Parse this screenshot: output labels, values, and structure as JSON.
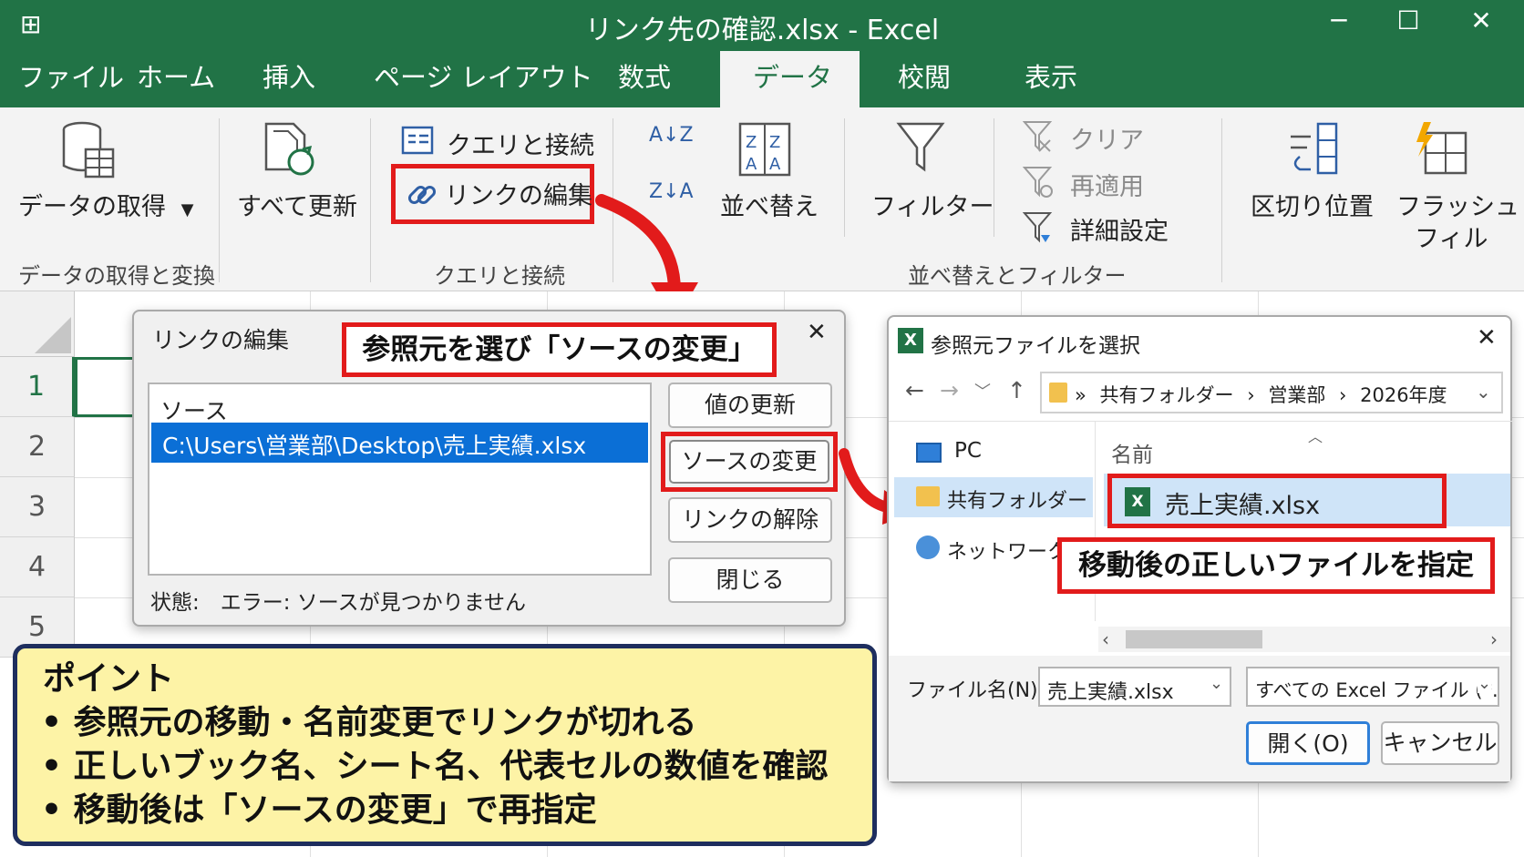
{
  "window": {
    "title": "リンク先の確認.xlsx - Excel",
    "controls": {
      "minimize": "─",
      "maximize": "☐",
      "close": "✕"
    }
  },
  "tabs": [
    "ファイル",
    "ホーム",
    "挿入",
    "ページ レイアウト",
    "数式",
    "データ",
    "校閲",
    "表示"
  ],
  "active_tab": "データ",
  "ribbon": {
    "get_data": "データの取得",
    "refresh_all": "すべて更新",
    "queries": "クエリと接続",
    "edit_links": "リンクの編集",
    "sort": "並べ替え",
    "sort_az": "A↓Z",
    "sort_za": "Z↓A",
    "filter": "フィルター",
    "clear": "クリア",
    "reapply": "再適用",
    "advanced": "詳細設定",
    "text_to_columns": "区切り位置",
    "flash_fill_1": "フラッシュ",
    "flash_fill_2": "フィル",
    "groups": {
      "get_transform": "データの取得と変換",
      "queries": "クエリと接続",
      "sort_filter": "並べ替えとフィルター"
    }
  },
  "rows": [
    "1",
    "2",
    "3",
    "4",
    "5"
  ],
  "edit_links_dialog": {
    "title": "リンクの編集",
    "close": "✕",
    "column_header": "ソース",
    "selected_source": "C:\\Users\\営業部\\Desktop\\売上実績.xlsx",
    "buttons": {
      "update": "値の更新",
      "change_source": "ソースの変更",
      "break": "リンクの解除",
      "close": "閉じる"
    },
    "status": "状態:　エラー: ソースが見つかりません"
  },
  "callout_select": "参照元を選び「ソースの変更」",
  "file_dialog": {
    "title": "参照元ファイルを選択",
    "close": "✕",
    "nav": {
      "back": "←",
      "forward": "→",
      "recent": "﹀",
      "up": "↑"
    },
    "breadcrumb": {
      "sep0": "»",
      "a": "共有フォルダー",
      "b": "営業部",
      "c": "2026年度",
      "sep": "›"
    },
    "sidebar": [
      "PC",
      "共有フォルダー",
      "ネットワーク"
    ],
    "column_header": "名前",
    "file": "売上実績.xlsx",
    "filename_label": "ファイル名(N):",
    "filename_value": "売上実績.xlsx",
    "filetype": "すべての Excel ファイル (*.xl",
    "open_button": "開く(O)",
    "cancel_button": "キャンセル"
  },
  "callout_file": "移動後の正しいファイルを指定",
  "point": {
    "title": "ポイント",
    "bullets": [
      "• 参照元の移動・名前変更でリンクが切れる",
      "• 正しいブック名、シート名、代表セルの数値を確認",
      "• 移動後は「ソースの変更」で再指定"
    ]
  },
  "colors": {
    "excel_green": "#217346",
    "highlight_red": "#e21b1b",
    "selection_blue": "#0b6fd6",
    "point_bg": "#fdf3a6"
  }
}
